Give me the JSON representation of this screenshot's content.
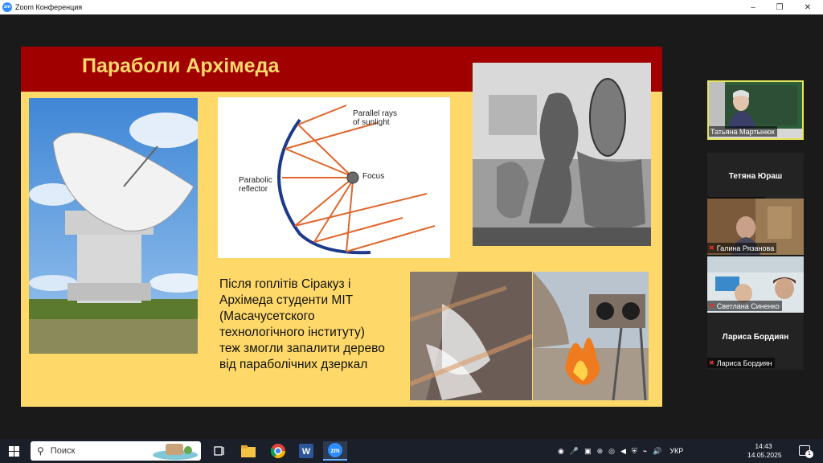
{
  "window": {
    "logo": "zm",
    "title": "Zoom Конференция",
    "controls": {
      "minimize": "–",
      "maximize": "❐",
      "close": "✕"
    }
  },
  "slide": {
    "title": "Параболи Архімеда",
    "diagram": {
      "parallel_rays_line1": "Parallel rays",
      "parallel_rays_line2": "of sunlight",
      "reflector_line1": "Parabolic",
      "reflector_line2": "reflector",
      "focus": "Focus"
    },
    "body_lines": [
      "Після гоплітів Сіракуз і",
      "Архімеда студенти МІТ",
      "(Масачусетского",
      "технологічного інституту)",
      "теж змогли запалити дерево",
      "від параболічних дзеркал"
    ],
    "colors": {
      "header": "#a10000",
      "background": "#fed96a",
      "title": "#ffd96a"
    }
  },
  "participants": [
    {
      "name": "Татьяна Мартынюк",
      "video": true,
      "active_speaker": true
    },
    {
      "name": "Тетяна Юраш",
      "video": false,
      "muted": true
    },
    {
      "name": "Галина Рязанова",
      "video": true,
      "muted": true
    },
    {
      "name": "Светлана Синенко",
      "video": true,
      "muted": true
    },
    {
      "name": "Лариса Бордиян",
      "video": false,
      "muted": true
    }
  ],
  "taskbar": {
    "search_placeholder": "Поиск",
    "pinned": [
      "file-explorer",
      "chrome",
      "word",
      "zoom"
    ],
    "language": "УКР",
    "time": "14:43",
    "date": "14.05.2025",
    "notifications": "1"
  }
}
